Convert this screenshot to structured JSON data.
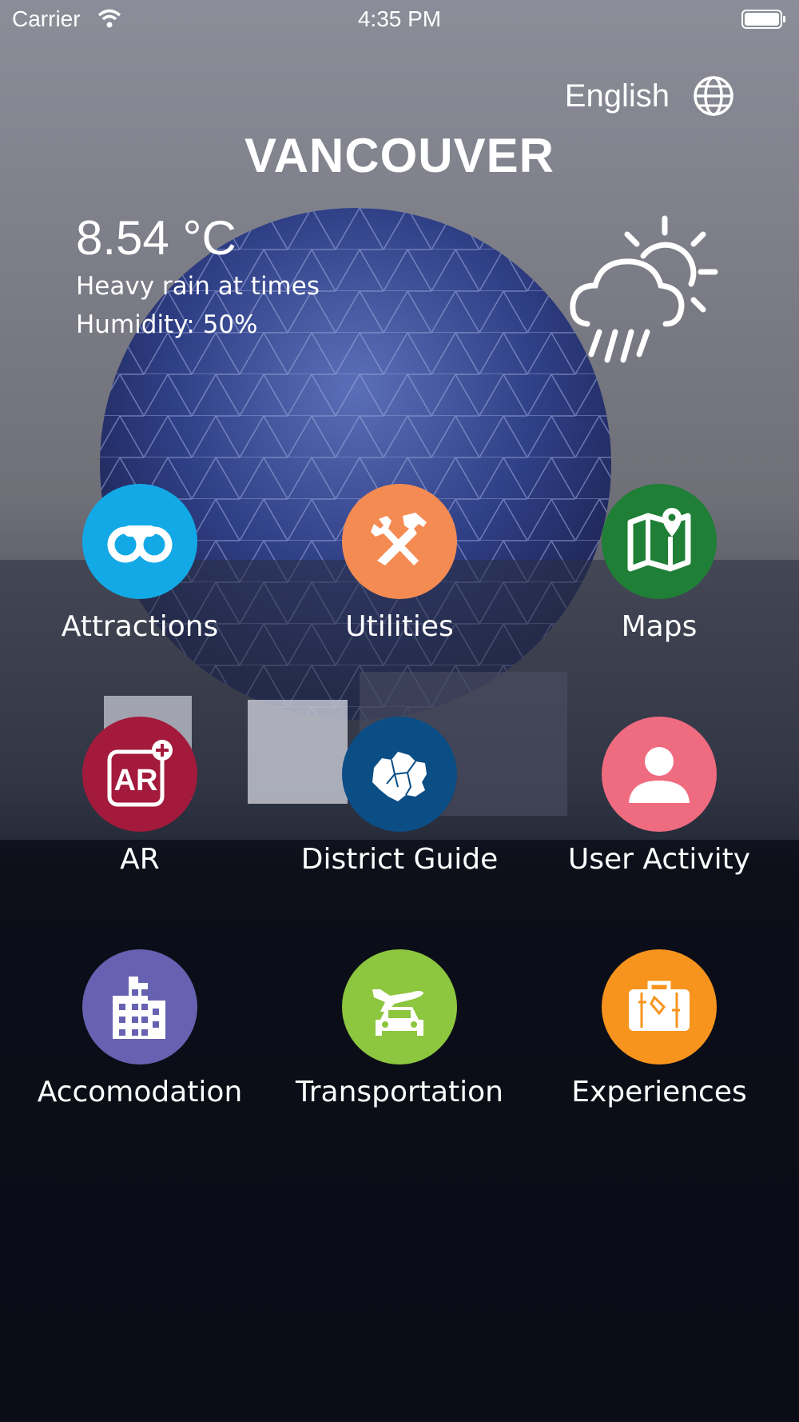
{
  "status_bar": {
    "carrier": "Carrier",
    "time": "4:35 PM"
  },
  "language": {
    "label": "English",
    "icon": "globe-icon"
  },
  "city": "VANCOUVER",
  "weather": {
    "temperature": "8.54 °C",
    "condition": "Heavy rain at times",
    "humidity": "Humidity: 50%",
    "icon": "rain-sun-cloud-icon"
  },
  "menu": [
    {
      "label": "Attractions",
      "icon": "binoculars-icon",
      "color": "#13a9e6"
    },
    {
      "label": "Utilities",
      "icon": "tools-icon",
      "color": "#f48b53"
    },
    {
      "label": "Maps",
      "icon": "map-pin-icon",
      "color": "#1f7f36"
    },
    {
      "label": "AR",
      "icon": "ar-icon",
      "color": "#a31a3c",
      "icon_text": "AR"
    },
    {
      "label": "District Guide",
      "icon": "district-map-icon",
      "color": "#0b4d85"
    },
    {
      "label": "User Activity",
      "icon": "user-icon",
      "color": "#ef6b80"
    },
    {
      "label": "Accomodation",
      "icon": "building-icon",
      "color": "#6661b1"
    },
    {
      "label": "Transportation",
      "icon": "plane-car-icon",
      "color": "#8dc63f"
    },
    {
      "label": "Experiences",
      "icon": "suitcase-icon",
      "color": "#f7941d"
    }
  ]
}
